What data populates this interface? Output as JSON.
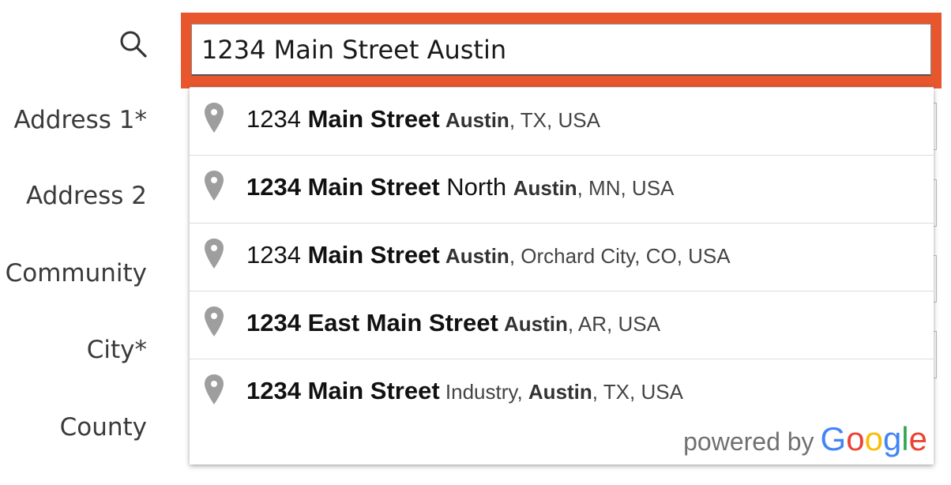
{
  "form": {
    "search_value": "1234 Main Street Austin",
    "labels": {
      "address1": "Address 1*",
      "address2": "Address 2",
      "community": "Community",
      "city": "City*",
      "county": "County"
    }
  },
  "suggestions": [
    {
      "pre": "1234 ",
      "bold1": "Main Street",
      "mid": " ",
      "bold2": "Austin",
      "post": ", TX, USA"
    },
    {
      "bold_main": "1234 Main Street",
      "main_rest": " North ",
      "bold2": "Austin",
      "post": ", MN, USA"
    },
    {
      "pre": "1234 ",
      "bold1": "Main Street",
      "mid": " ",
      "bold2": "Austin",
      "post": ", Orchard City, CO, USA"
    },
    {
      "bold_main": "1234 East Main Street",
      "mid": " ",
      "bold2": "Austin",
      "post": ", AR, USA"
    },
    {
      "bold_main": "1234 Main Street",
      "sec_pre": " Industry, ",
      "bold2": "Austin",
      "post": ", TX, USA"
    }
  ],
  "attribution": {
    "powered_by": "powered by",
    "google_letters": [
      "G",
      "o",
      "o",
      "g",
      "l",
      "e"
    ]
  },
  "colors": {
    "focus_border": "#e8562e",
    "pin": "#9e9e9e",
    "google": [
      "#4285F4",
      "#EA4335",
      "#FBBC05",
      "#4285F4",
      "#34A853",
      "#EA4335"
    ]
  },
  "icons": {
    "search": "search-icon",
    "pin": "map-pin-icon"
  }
}
